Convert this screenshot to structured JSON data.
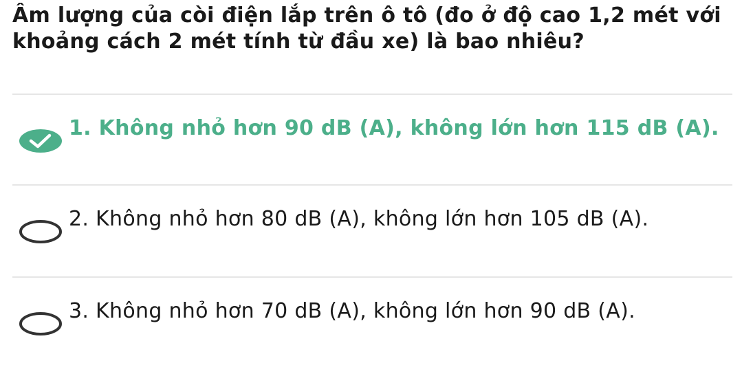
{
  "question": {
    "text": "Âm lượng của còi điện lắp trên ô tô (đo ở độ cao 1,2 mét với khoảng cách 2 mét tính từ đầu xe) là bao nhiêu?"
  },
  "options": [
    {
      "label": "1. Không nhỏ hơn 90 dB (A), không lớn hơn 115 dB (A).",
      "state": "correct",
      "icon": "check-circle-icon"
    },
    {
      "label": "2. Không nhỏ hơn 80 dB (A), không lớn hơn 105 dB (A).",
      "state": "unselected",
      "icon": "radio-empty-icon"
    },
    {
      "label": "3. Không nhỏ hơn 70 dB (A), không lớn hơn 90 dB (A).",
      "state": "unselected",
      "icon": "radio-empty-icon"
    }
  ],
  "colors": {
    "correct": "#4caf8a",
    "text": "#1a1a1a",
    "divider": "#e6e6e6"
  }
}
